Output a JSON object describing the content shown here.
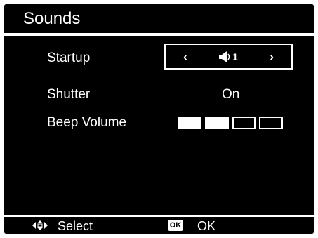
{
  "title": "Sounds",
  "menu": {
    "startup": {
      "label": "Startup",
      "value": "1",
      "left_arrow": "‹",
      "right_arrow": "›",
      "icon": "speaker-icon"
    },
    "shutter": {
      "label": "Shutter",
      "value": "On"
    },
    "beep_volume": {
      "label": "Beep Volume",
      "level": 2,
      "max": 4
    }
  },
  "footer": {
    "select_icon": "four-way-nav-icon",
    "select_label": "Select",
    "ok_icon": "OK",
    "ok_label": "OK"
  },
  "colors": {
    "background": "#000000",
    "foreground": "#ffffff"
  }
}
